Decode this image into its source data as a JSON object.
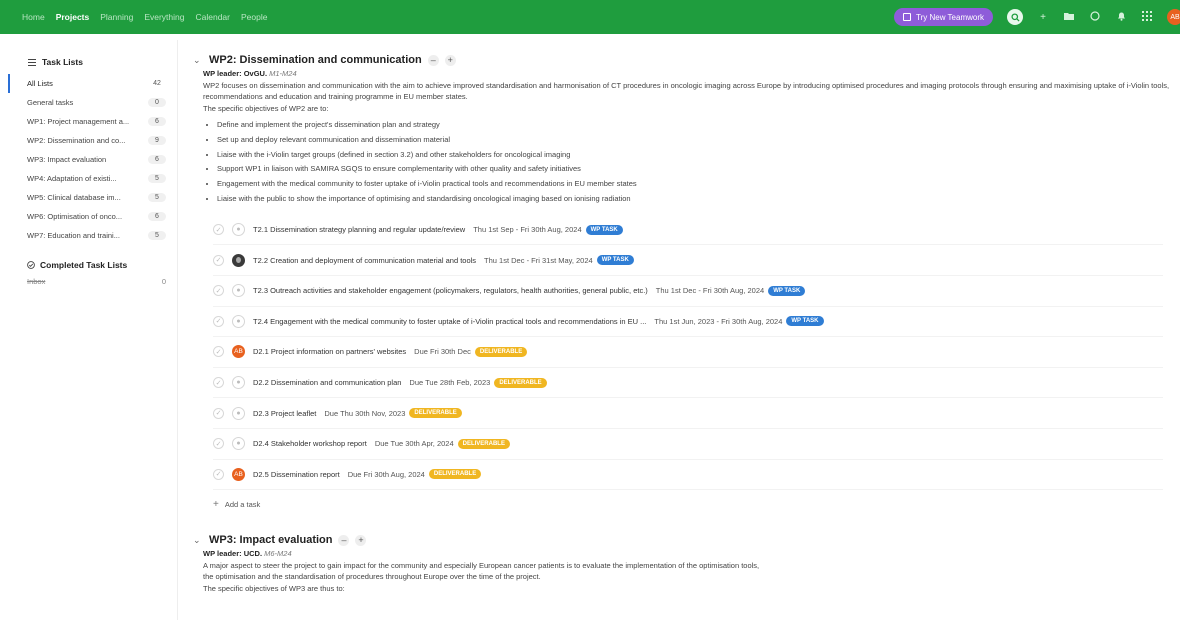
{
  "nav": {
    "items": [
      {
        "label": "Home",
        "active": false
      },
      {
        "label": "Projects",
        "active": true
      },
      {
        "label": "Planning",
        "active": false
      },
      {
        "label": "Everything",
        "active": false
      },
      {
        "label": "Calendar",
        "active": false
      },
      {
        "label": "People",
        "active": false
      }
    ],
    "try_button": "Try New Teamwork",
    "avatar": "AB",
    "icons": [
      "search-icon",
      "plus-icon",
      "folder-icon",
      "timer-icon",
      "bell-icon",
      "apps-grid-icon"
    ]
  },
  "sidebar": {
    "header": "Task Lists",
    "items": [
      {
        "label": "All Lists",
        "count": "42"
      },
      {
        "label": "General tasks",
        "count": "0"
      },
      {
        "label": "WP1: Project management a...",
        "count": "6"
      },
      {
        "label": "WP2: Dissemination and co...",
        "count": "9"
      },
      {
        "label": "WP3: Impact evaluation",
        "count": "6"
      },
      {
        "label": "WP4: Adaptation of existi...",
        "count": "5"
      },
      {
        "label": "WP5: Clinical database im...",
        "count": "5"
      },
      {
        "label": "WP6: Optimisation of onco...",
        "count": "6"
      },
      {
        "label": "WP7: Education and traini...",
        "count": "5"
      }
    ],
    "completed_header": "Completed Task Lists",
    "completed_items": [
      {
        "label": "Inbox",
        "count": "0"
      }
    ]
  },
  "wp2": {
    "title": "WP2: Dissemination and communication",
    "leader_label": "WP leader: OvGU.",
    "leader_period": "M1-M24",
    "description": "WP2 focuses on dissemination and communication with the aim to achieve improved standardisation and harmonisation of CT procedures in oncologic imaging across Europe by introducing optimised procedures and imaging protocols through ensuring and maximising uptake of i-Violin tools, recommendations and education and training programme in EU member states.",
    "objectives_intro": "The specific objectives of WP2 are to:",
    "objectives": [
      "Define and implement the project's dissemination plan and strategy",
      "Set up and deploy relevant communication and dissemination material",
      "Liaise with the i-Violin target groups (defined in section 3.2) and other stakeholders for oncological imaging",
      "Support WP1 in liaison with SAMIRA SGQS to ensure complementarity with other quality and safety initiatives",
      "Engagement with the medical community to foster uptake of i-Violin practical tools and recommendations in EU member states",
      "Liaise with the public to show the importance of optimising and standardising oncological imaging based on ionising radiation"
    ],
    "tasks": [
      {
        "name": "T2.1 Dissemination strategy planning and regular update/review",
        "date": "Thu 1st Sep - Fri 30th Aug, 2024",
        "tag": "WP TASK",
        "tag_type": "wp",
        "assignee": "none"
      },
      {
        "name": "T2.2 Creation and deployment of communication material and tools",
        "date": "Thu 1st Dec - Fri 31st May, 2024",
        "tag": "WP TASK",
        "tag_type": "wp",
        "assignee": "photo"
      },
      {
        "name": "T2.3 Outreach activities and stakeholder engagement (policymakers, regulators, health authorities, general public, etc.)",
        "date": "Thu 1st Dec - Fri 30th Aug, 2024",
        "tag": "WP TASK",
        "tag_type": "wp",
        "assignee": "none"
      },
      {
        "name": "T2.4 Engagement with the medical community to foster uptake of i-Violin practical tools and recommendations in EU ...",
        "date": "Thu 1st Jun, 2023 - Fri 30th Aug, 2024",
        "tag": "WP TASK",
        "tag_type": "wp",
        "assignee": "none"
      },
      {
        "name": "D2.1 Project information on partners' websites",
        "date": "Due Fri 30th Dec",
        "tag": "DELIVERABLE",
        "tag_type": "del",
        "assignee": "AB"
      },
      {
        "name": "D2.2 Dissemination and communication plan",
        "date": "Due Tue 28th Feb, 2023",
        "tag": "DELIVERABLE",
        "tag_type": "del",
        "assignee": "none"
      },
      {
        "name": "D2.3 Project leaflet",
        "date": "Due Thu 30th Nov, 2023",
        "tag": "DELIVERABLE",
        "tag_type": "del",
        "assignee": "none"
      },
      {
        "name": "D2.4 Stakeholder workshop report",
        "date": "Due Tue 30th Apr, 2024",
        "tag": "DELIVERABLE",
        "tag_type": "del",
        "assignee": "none"
      },
      {
        "name": "D2.5 Dissemination report",
        "date": "Due Fri 30th Aug, 2024",
        "tag": "DELIVERABLE",
        "tag_type": "del",
        "assignee": "AB"
      }
    ],
    "add_task": "Add a task"
  },
  "wp3": {
    "title": "WP3: Impact evaluation",
    "leader_label": "WP leader: UCD.",
    "leader_period": "M6-M24",
    "description_lines": [
      "A major aspect to steer the project to gain impact for the community and especially European cancer patients is to evaluate the implementation of the optimisation tools,",
      "the optimisation and the standardisation of procedures throughout Europe over the time of the project."
    ],
    "objectives_intro": "The specific objectives of WP3 are thus to:"
  },
  "colors": {
    "topbar": "#1f9d3e",
    "try_button": "#8e5cd9",
    "wp_tag": "#2f7dd4",
    "deliverable_tag": "#f0b621",
    "avatar": "#e8611f"
  }
}
